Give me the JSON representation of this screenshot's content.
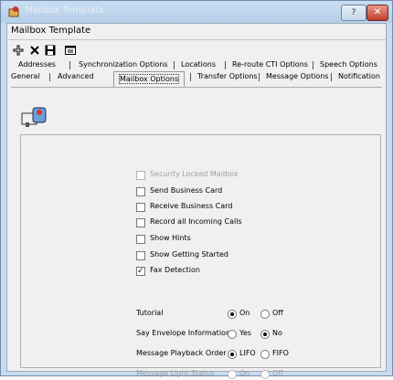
{
  "window": {
    "title": "Mailbox Template",
    "help_label": "?",
    "close_label": "✕"
  },
  "menubar": {
    "items": [
      {
        "label": "Mailbox Template"
      }
    ]
  },
  "toolbar": {
    "buttons": [
      "new-icon",
      "delete-icon",
      "save-icon",
      "properties-icon"
    ]
  },
  "tabs": {
    "row1": [
      {
        "label": "Addresses"
      },
      {
        "label": "Synchronization Options"
      },
      {
        "label": "Locations"
      },
      {
        "label": "Re-route CTI Options"
      },
      {
        "label": "Speech Options"
      }
    ],
    "row2": [
      {
        "label": "General"
      },
      {
        "label": "Advanced"
      },
      {
        "label": "Mailbox Options",
        "active": true
      },
      {
        "label": "Transfer Options"
      },
      {
        "label": "Message Options"
      },
      {
        "label": "Notification"
      }
    ]
  },
  "checkboxes": [
    {
      "label": "Security Locked Mailbox",
      "checked": false,
      "enabled": false
    },
    {
      "label": "Send Business Card",
      "checked": false,
      "enabled": true
    },
    {
      "label": "Receive Business Card",
      "checked": false,
      "enabled": true
    },
    {
      "label": "Record all Incoming Calls",
      "checked": false,
      "enabled": true
    },
    {
      "label": "Show Hints",
      "checked": false,
      "enabled": true
    },
    {
      "label": "Show Getting Started",
      "checked": false,
      "enabled": true
    },
    {
      "label": "Fax Detection",
      "checked": true,
      "enabled": true
    }
  ],
  "options": [
    {
      "label": "Tutorial",
      "choices": [
        "On",
        "Off"
      ],
      "selected": "On",
      "enabled": true
    },
    {
      "label": "Say Envelope Information",
      "choices": [
        "Yes",
        "No"
      ],
      "selected": "No",
      "enabled": true
    },
    {
      "label": "Message Playback Order",
      "choices": [
        "LIFO",
        "FIFO"
      ],
      "selected": "LIFO",
      "enabled": true
    },
    {
      "label": "Message Light Status",
      "choices": [
        "On",
        "Off"
      ],
      "selected": "",
      "enabled": false
    }
  ]
}
